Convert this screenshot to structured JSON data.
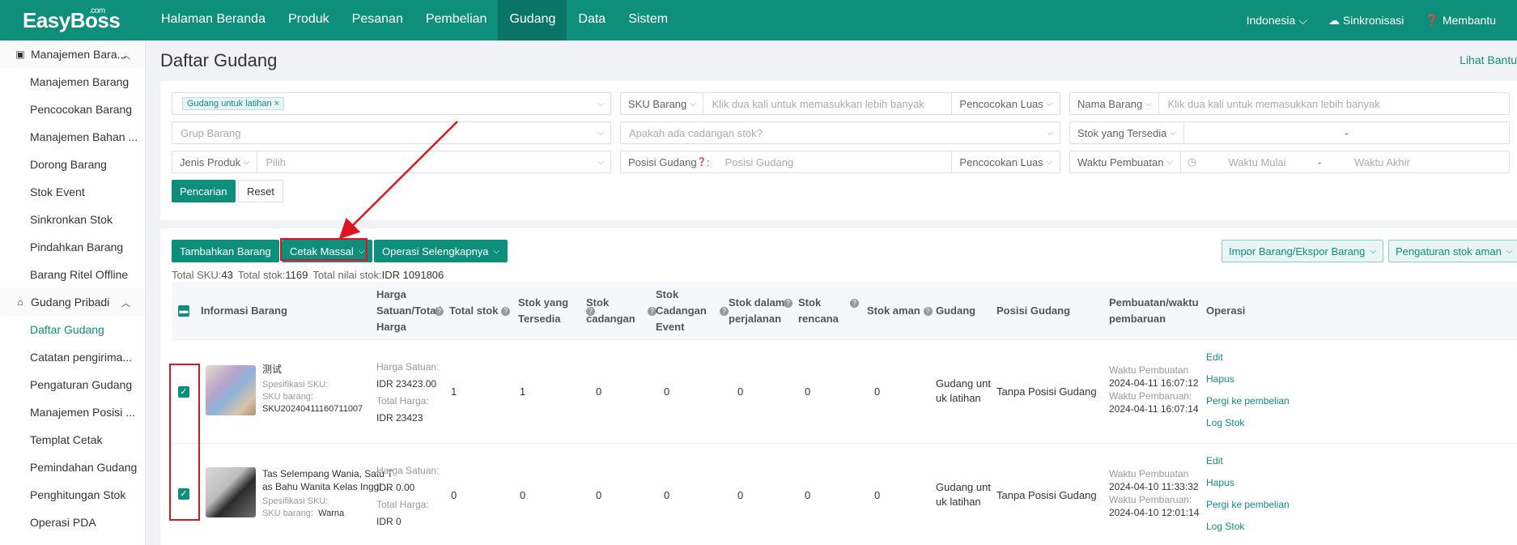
{
  "top": {
    "logo": "EasyBoss",
    "logo_sup": ".com",
    "nav": [
      "Halaman Beranda",
      "Produk",
      "Pesanan",
      "Pembelian",
      "Gudang",
      "Data",
      "Sistem"
    ],
    "active_nav": "Gudang",
    "language": "Indonesia",
    "sync": "Sinkronisasi",
    "help": "Membantu"
  },
  "sidebar": {
    "group1": "Manajemen Bara...",
    "group1_items": [
      "Manajemen Barang",
      "Pencocokan Barang",
      "Manajemen Bahan ...",
      "Dorong Barang",
      "Stok Event",
      "Sinkronkan Stok",
      "Pindahkan Barang",
      "Barang Ritel Offline"
    ],
    "group2": "Gudang Pribadi",
    "group2_items": [
      "Daftar Gudang",
      "Catatan pengirima...",
      "Pengaturan Gudang",
      "Manajemen Posisi ...",
      "Templat Cetak",
      "Pemindahan Gudang",
      "Penghitungan Stok",
      "Operasi PDA"
    ],
    "active_item": "Daftar Gudang"
  },
  "page": {
    "title": "Daftar Gudang",
    "help_link": "Lihat Bantu"
  },
  "filters": {
    "warehouse_tag": "Gudang untuk latihan",
    "sku_label": "SKU Barang",
    "sku_placeholder": "Klik dua kali untuk memasukkan lebih banyak",
    "match1": "Pencocokan Luas",
    "name_label": "Nama Barang",
    "name_placeholder": "Klik dua kali untuk memasukkan lebih banyak",
    "group_placeholder": "Grup Barang",
    "reserve_placeholder": "Apakah ada cadangan stok?",
    "avail_label": "Stok yang Tersedia",
    "range_sep": "-",
    "type_label": "Jenis Produk",
    "type_placeholder": "Pilih",
    "pos_label": "Posisi Gudang",
    "pos_placeholder": "Posisi Gudang",
    "match2": "Pencocokan Luas",
    "time_label": "Waktu Pembuatan",
    "time_start": "Waktu Mulai",
    "time_end": "Waktu Akhir",
    "search": "Pencarian",
    "reset": "Reset"
  },
  "toolbar": {
    "add": "Tambahkan Barang",
    "print": "Cetak Massal",
    "more": "Operasi Selengkapnya",
    "import_export": "Impor Barang/Ekspor Barang",
    "safe_stock": "Pengaturan stok aman"
  },
  "summary": {
    "sku_label": "Total SKU:",
    "sku": "43",
    "stock_label": "Total stok:",
    "stock": "1169",
    "value_label": "Total nilai stok:",
    "value": "IDR 1091806"
  },
  "columns": {
    "info": "Informasi Barang",
    "price": "Harga Satuan/Tota l Harga",
    "total": "Total stok",
    "available": "Stok yang Tersedia",
    "reserve": "Stok cadangan",
    "event_reserve": "Stok Cadangan Event",
    "transit": "Stok dalam perjalanan",
    "plan": "Stok rencana",
    "safe": "Stok aman",
    "warehouse": "Gudang",
    "position": "Posisi Gudang",
    "time": "Pembuatan/waktu pembaruan",
    "ops": "Operasi"
  },
  "labels": {
    "unit_price": "Harga Satuan:",
    "total_price": "Total Harga:",
    "sku_spec": "Spesifikasi SKU:",
    "sku_code": "SKU barang:",
    "created": "Waktu Pembuatan",
    "updated": "Waktu Pembaruan:",
    "op_edit": "Edit",
    "op_delete": "Hapus",
    "op_purchase": "Pergi ke pembelian",
    "op_log": "Log Stok"
  },
  "rows": [
    {
      "name": "测试",
      "sku_value": "SKU20240411160711007",
      "unit_price": "IDR 23423.00",
      "total_price": "IDR 23423",
      "total": "1",
      "available": "1",
      "reserve": "0",
      "event_reserve": "0",
      "transit": "0",
      "plan": "0",
      "safe": "0",
      "warehouse": "Gudang unt uk latihan",
      "position": "Tanpa Posisi Gudang",
      "created": "2024-04-11 16:07:12",
      "updated": "2024-04-11 16:07:14",
      "thumb_color": "#c9a98a"
    },
    {
      "name": "Tas Selempang Wania, Satu T as Bahu Wanita Kelas Inggi ...",
      "sku_value": "Warna",
      "unit_price": "IDR 0.00",
      "total_price": "IDR 0",
      "total": "0",
      "available": "0",
      "reserve": "0",
      "event_reserve": "0",
      "transit": "0",
      "plan": "0",
      "safe": "0",
      "warehouse": "Gudang unt uk latihan",
      "position": "Tanpa Posisi Gudang",
      "created": "2024-04-10 11:33:32",
      "updated": "2024-04-10 12:01:14",
      "thumb_color": "#8a8a8a"
    }
  ],
  "colors": {
    "brand": "#0e8f7c",
    "annotation": "#e0141e"
  }
}
